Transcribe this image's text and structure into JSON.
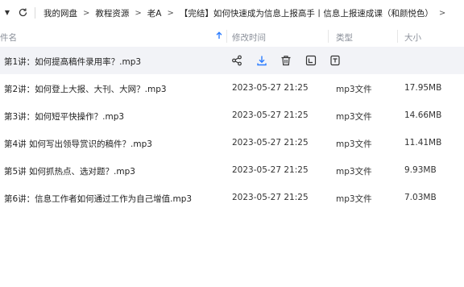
{
  "breadcrumb": {
    "items": [
      "我的网盘",
      "教程资源",
      "老A",
      "【完结】如何快速成为信息上报高手丨信息上报速成课（和颜悦色）"
    ],
    "separator": ">",
    "trailing": ">"
  },
  "header": {
    "name": "件名",
    "modified": "修改时间",
    "type": "类型",
    "size": "大小"
  },
  "files": [
    {
      "name": "第1讲：如何提高稿件录用率？.mp3",
      "modified": "",
      "type": "",
      "size": ""
    },
    {
      "name": "第2讲：如何登上大报、大刊、大网？.mp3",
      "modified": "2023-05-27 21:25",
      "type": "mp3文件",
      "size": "17.95MB"
    },
    {
      "name": "第3讲：如何短平快操作？.mp3",
      "modified": "2023-05-27 21:25",
      "type": "mp3文件",
      "size": "14.66MB"
    },
    {
      "name": "第4讲 如何写出领导赏识的稿件？.mp3",
      "modified": "2023-05-27 21:25",
      "type": "mp3文件",
      "size": "11.41MB"
    },
    {
      "name": "第5讲 如何抓热点、选对题？.mp3",
      "modified": "2023-05-27 21:25",
      "type": "mp3文件",
      "size": "9.93MB"
    },
    {
      "name": "第6讲：信息工作者如何通过工作为自己增值.mp3",
      "modified": "2023-05-27 21:25",
      "type": "mp3文件",
      "size": "7.03MB"
    }
  ],
  "row_actions": [
    "share-icon",
    "download-icon",
    "delete-icon",
    "rename-icon",
    "more-icon"
  ],
  "colors": {
    "hover_bg": "#f2f3f7",
    "accent": "#2b7cff",
    "header_text": "#8a8f99"
  }
}
